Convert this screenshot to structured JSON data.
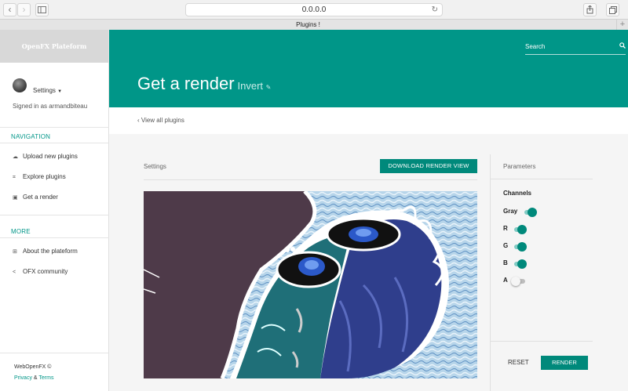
{
  "browser": {
    "url": "0.0.0.0",
    "tab_title": "Plugins !",
    "back_icon": "chevron-left-icon",
    "forward_icon": "chevron-right-icon",
    "sidebar_icon": "sidebar-icon",
    "reload_icon": "reload-icon",
    "share_icon": "share-icon",
    "tabs_icon": "tabs-icon",
    "new_tab_icon": "plus-icon"
  },
  "sidebar": {
    "brand": "OpenFX Plateform",
    "settings_label": "Settings",
    "signed_in": "Signed in as armandbiteau",
    "navigation_title": "NAVIGATION",
    "navigation_items": [
      {
        "label": "Upload new plugins",
        "icon": "cloud-upload-icon"
      },
      {
        "label": "Explore plugins",
        "icon": "crop-icon"
      },
      {
        "label": "Get a render",
        "icon": "image-icon"
      }
    ],
    "more_title": "MORE",
    "more_items": [
      {
        "label": "About the plateform",
        "icon": "sitemap-icon"
      },
      {
        "label": "OFX community",
        "icon": "share-alt-icon"
      }
    ],
    "footer_brand": "WebOpenFX ©",
    "privacy": "Privacy",
    "amp": "&",
    "terms": "Terms"
  },
  "header": {
    "search_placeholder": "Search",
    "title": "Get a render",
    "plugin_name": "Invert"
  },
  "breadcrumb": {
    "back_label": "‹ View all plugins"
  },
  "settings_panel": {
    "title": "Settings",
    "download_button": "DOWNLOAD RENDER VIEW"
  },
  "parameters": {
    "title": "Parameters",
    "channels_title": "Channels",
    "channels": [
      {
        "label": "Gray",
        "on": true
      },
      {
        "label": "R",
        "on": true
      },
      {
        "label": "G",
        "on": true
      },
      {
        "label": "B",
        "on": true
      },
      {
        "label": "A",
        "on": false
      }
    ],
    "reset_label": "RESET",
    "render_label": "RENDER"
  },
  "colors": {
    "accent": "#009688",
    "button": "#00897b"
  }
}
